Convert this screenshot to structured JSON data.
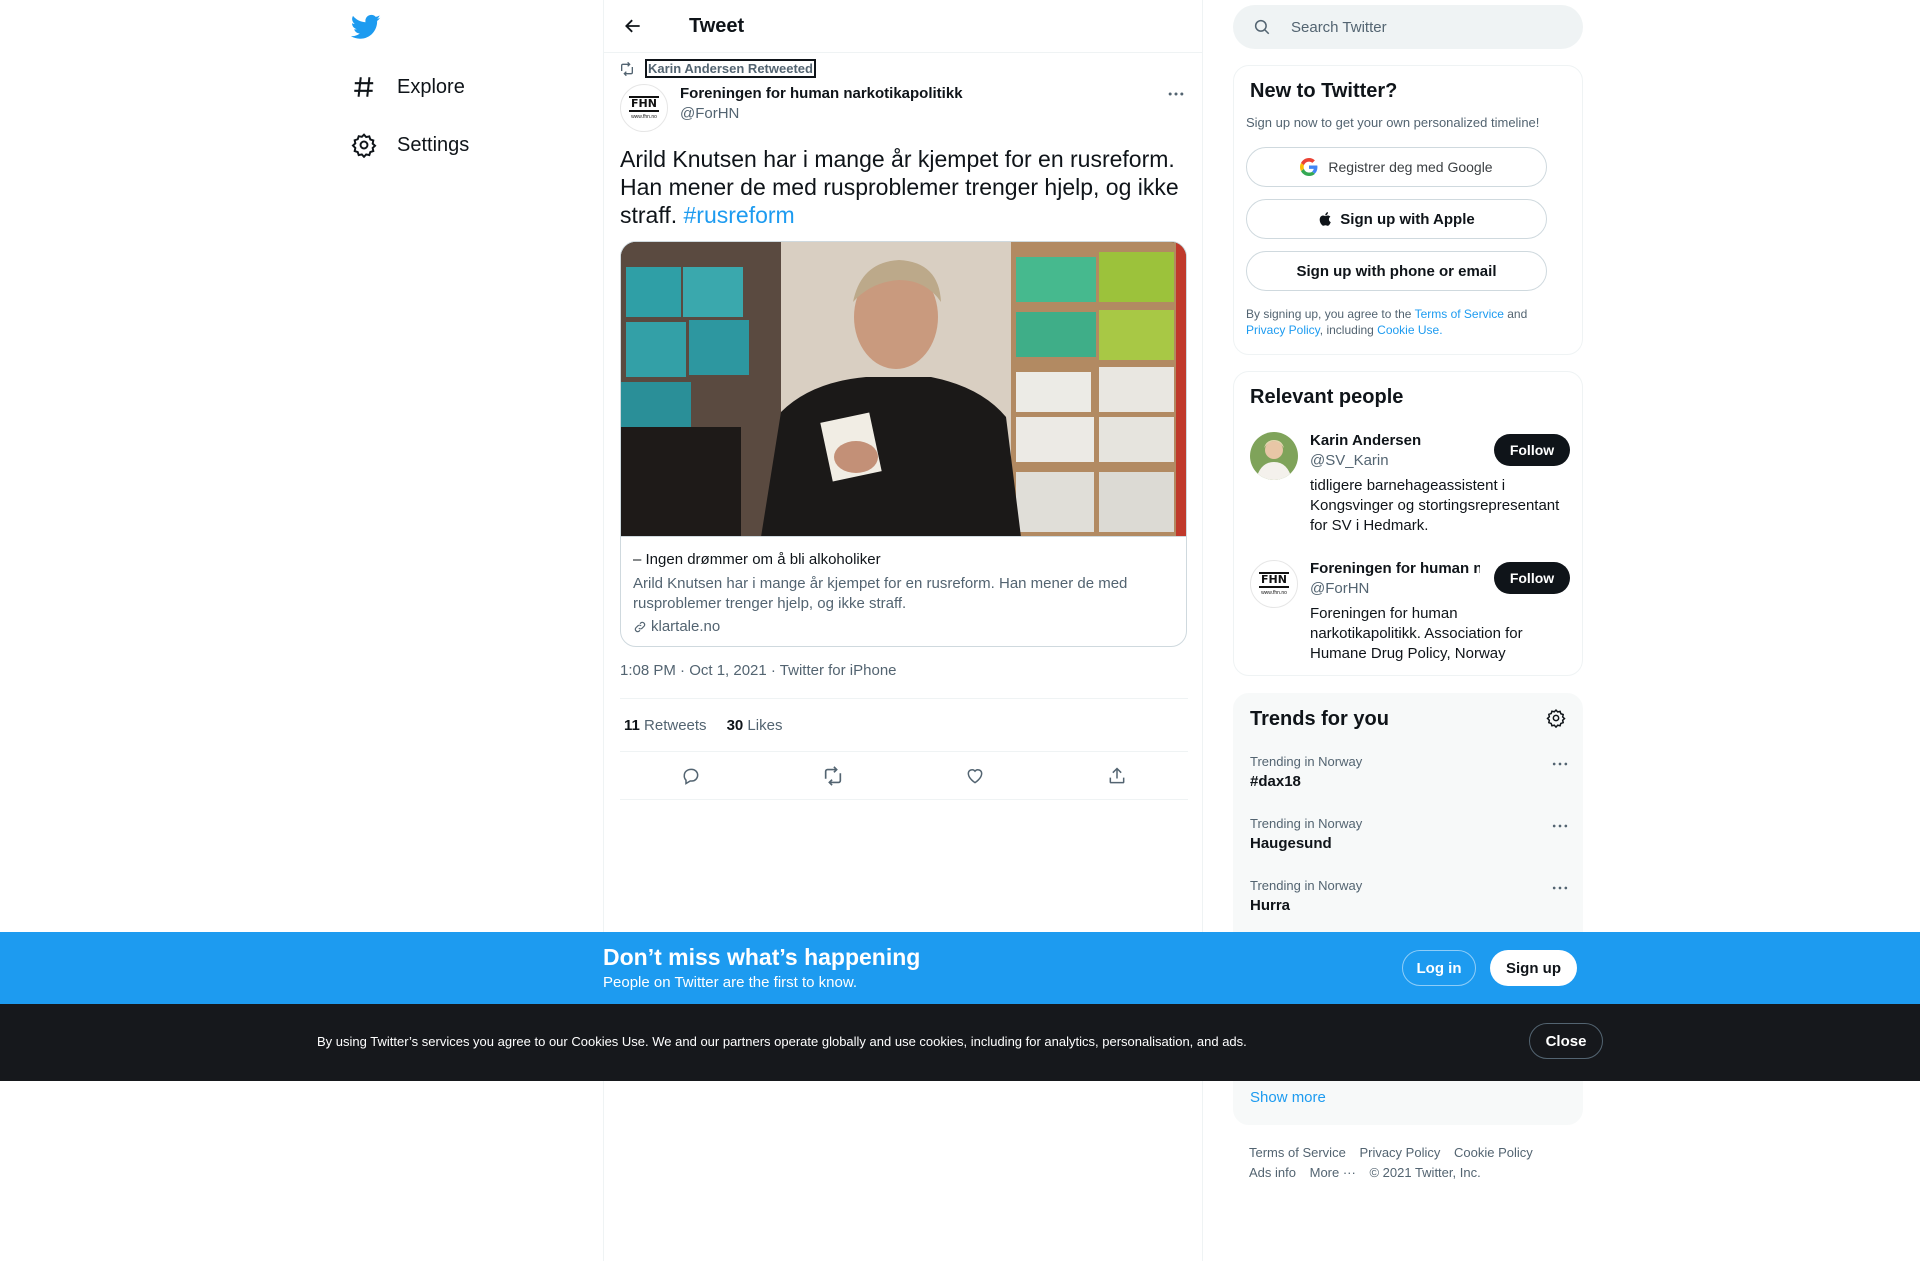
{
  "nav": {
    "logo_icon": "twitter-bird-icon",
    "items": [
      {
        "label": "Explore",
        "icon": "hashtag-icon"
      },
      {
        "label": "Settings",
        "icon": "gear-icon"
      }
    ]
  },
  "header": {
    "back_icon": "arrow-left-icon",
    "title": "Tweet"
  },
  "tweet": {
    "retweeted_by": "Karin Andersen Retweeted",
    "author_name": "Foreningen for human narkotikapolitikk",
    "author_handle": "@ForHN",
    "avatar_logo": "FHN",
    "avatar_url": "www.fhn.no",
    "text": "Arild Knutsen har i mange år kjempet for en rusreform. Han mener de med rusproblemer trenger hjelp, og ikke straff. ",
    "hashtag": "#rusreform",
    "card": {
      "title": "– Ingen drømmer om å bli alkoholiker",
      "description": "Arild Knutsen har i mange år kjempet for en rusreform. Han mener de med rusproblemer trenger hjelp, og ikke straff.",
      "domain": "klartale.no"
    },
    "meta": "1:08 PM · Oct 1, 2021 · Twitter for iPhone",
    "retweets_count": "11",
    "retweets_label": "Retweets",
    "likes_count": "30",
    "likes_label": "Likes"
  },
  "search": {
    "placeholder": "Search Twitter"
  },
  "new_to_twitter": {
    "title": "New to Twitter?",
    "subtitle": "Sign up now to get your own personalized timeline!",
    "google_label": "Registrer deg med Google",
    "apple_label": "Sign up with Apple",
    "phone_label": "Sign up with phone or email",
    "terms_prefix": "By signing up, you agree to the ",
    "terms_link": "Terms of Service",
    "terms_and": " and ",
    "privacy_link": "Privacy Policy",
    "terms_including": ", including ",
    "cookie_link": "Cookie Use."
  },
  "relevant_people": {
    "title": "Relevant people",
    "people": [
      {
        "name": "Karin Andersen",
        "handle": "@SV_Karin",
        "bio": "tidligere barnehageassistent i Kongsvinger og stortingsrepresentant for SV i Hedmark.",
        "follow_label": "Follow"
      },
      {
        "name": "Foreningen for human narkotikapolitikk",
        "handle": "@ForHN",
        "bio": "Foreningen for human narkotikapolitikk. Association for Humane Drug Policy, Norway",
        "follow_label": "Follow"
      }
    ]
  },
  "trends": {
    "title": "Trends for you",
    "items": [
      {
        "context": "Trending in Norway",
        "name": "#dax18"
      },
      {
        "context": "Trending in Norway",
        "name": "Haugesund"
      },
      {
        "context": "Trending in Norway",
        "name": "Hurra"
      }
    ],
    "show_more": "Show more"
  },
  "footer": {
    "links": [
      "Terms of Service",
      "Privacy Policy",
      "Cookie Policy",
      "Ads info",
      "More ···"
    ],
    "copyright": "© 2021 Twitter, Inc."
  },
  "banner": {
    "title": "Don’t miss what’s happening",
    "subtitle": "People on Twitter are the first to know.",
    "login_label": "Log in",
    "signup_label": "Sign up"
  },
  "cookie_bar": {
    "text": "By using Twitter’s services you agree to our Cookies Use. We and our partners operate globally and use cookies, including for analytics, personalisation, and ads.",
    "close_label": "Close"
  },
  "colors": {
    "brand": "#1d9bf0",
    "text": "#0f1419",
    "secondary": "#536471",
    "cookie_bg": "#16181c"
  }
}
